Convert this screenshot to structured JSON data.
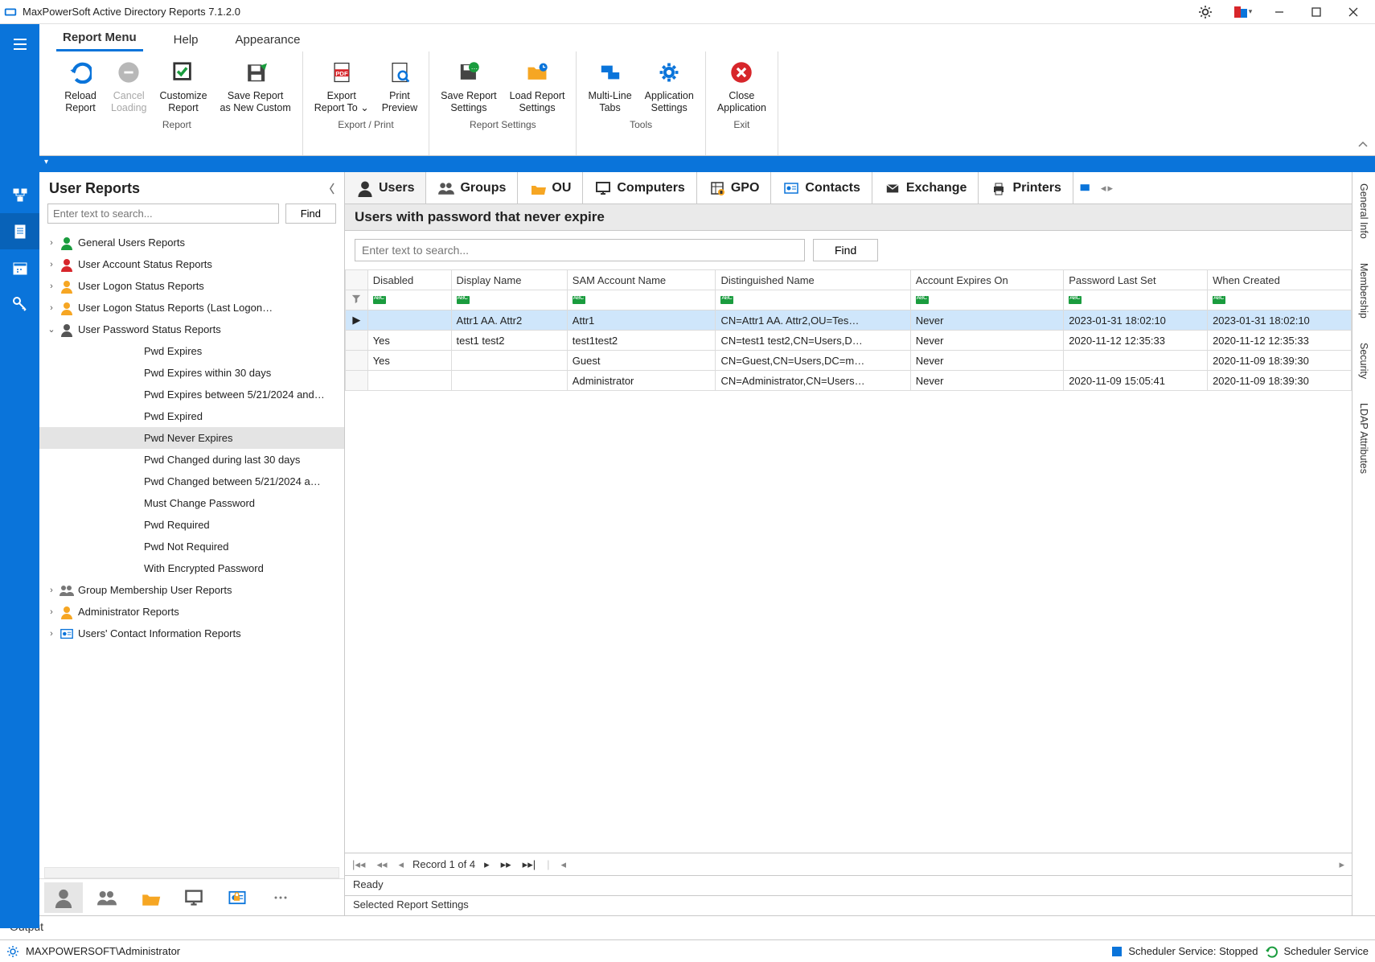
{
  "title": "MaxPowerSoft Active Directory Reports 7.1.2.0",
  "menu_tabs": [
    "Report Menu",
    "Help",
    "Appearance"
  ],
  "ribbon": {
    "groups": [
      {
        "caption": "Report",
        "items": [
          {
            "id": "reload",
            "l1": "Reload",
            "l2": "Report"
          },
          {
            "id": "cancel",
            "l1": "Cancel",
            "l2": "Loading",
            "disabled": true
          },
          {
            "id": "customize",
            "l1": "Customize",
            "l2": "Report"
          },
          {
            "id": "savecustom",
            "l1": "Save Report",
            "l2": "as New Custom"
          }
        ]
      },
      {
        "caption": "Export / Print",
        "items": [
          {
            "id": "export",
            "l1": "Export",
            "l2": "Report To ⌄"
          },
          {
            "id": "preview",
            "l1": "Print",
            "l2": "Preview"
          }
        ]
      },
      {
        "caption": "Report Settings",
        "items": [
          {
            "id": "savesettings",
            "l1": "Save Report",
            "l2": "Settings"
          },
          {
            "id": "loadsettings",
            "l1": "Load Report",
            "l2": "Settings"
          }
        ]
      },
      {
        "caption": "Tools",
        "items": [
          {
            "id": "multiline",
            "l1": "Multi-Line",
            "l2": "Tabs"
          },
          {
            "id": "appsettings",
            "l1": "Application",
            "l2": "Settings"
          }
        ]
      },
      {
        "caption": "Exit",
        "items": [
          {
            "id": "close",
            "l1": "Close",
            "l2": "Application"
          }
        ]
      }
    ]
  },
  "left_panel": {
    "title": "User Reports",
    "placeholder": "Enter text to search...",
    "find": "Find"
  },
  "tree": {
    "nodes": [
      {
        "level": 0,
        "exp": ">",
        "icon": "user-green",
        "label": "General Users Reports"
      },
      {
        "level": 0,
        "exp": ">",
        "icon": "user-red",
        "label": "User Account Status Reports"
      },
      {
        "level": 0,
        "exp": ">",
        "icon": "user-orange",
        "label": "User Logon Status Reports"
      },
      {
        "level": 0,
        "exp": ">",
        "icon": "user-orange",
        "label": "User Logon Status Reports (Last Logon…"
      },
      {
        "level": 0,
        "exp": "v",
        "icon": "user-pwd",
        "label": "User Password Status Reports"
      },
      {
        "level": 2,
        "label": "Pwd Expires"
      },
      {
        "level": 2,
        "label": "Pwd Expires within 30 days"
      },
      {
        "level": 2,
        "label": "Pwd Expires between 5/21/2024 and…"
      },
      {
        "level": 2,
        "label": "Pwd Expired"
      },
      {
        "level": 2,
        "label": "Pwd Never Expires",
        "sel": true
      },
      {
        "level": 2,
        "label": "Pwd Changed during last 30 days"
      },
      {
        "level": 2,
        "label": "Pwd Changed between 5/21/2024 a…"
      },
      {
        "level": 2,
        "label": "Must Change Password"
      },
      {
        "level": 2,
        "label": "Pwd Required"
      },
      {
        "level": 2,
        "label": "Pwd Not Required"
      },
      {
        "level": 2,
        "label": "With Encrypted Password"
      },
      {
        "level": 0,
        "exp": ">",
        "icon": "group",
        "label": "Group Membership User Reports"
      },
      {
        "level": 0,
        "exp": ">",
        "icon": "admin",
        "label": "Administrator Reports"
      },
      {
        "level": 0,
        "exp": ">",
        "icon": "card",
        "label": "Users' Contact Information Reports"
      }
    ]
  },
  "cat_tabs": [
    "Users",
    "Groups",
    "OU",
    "Computers",
    "GPO",
    "Contacts",
    "Exchange",
    "Printers"
  ],
  "grid": {
    "title": "Users with password that never expire",
    "placeholder": "Enter text to search...",
    "find": "Find",
    "cols": [
      "Disabled",
      "Display Name",
      "SAM Account Name",
      "Distinguished Name",
      "Account Expires On",
      "Password Last Set",
      "When Created"
    ],
    "rows": [
      {
        "sel": true,
        "hdr": "▶",
        "c": [
          "",
          "Attr1 AA. Attr2",
          "Attr1",
          "CN=Attr1 AA. Attr2,OU=Tes…",
          "Never",
          "2023-01-31 18:02:10",
          "2023-01-31 18:02:10"
        ]
      },
      {
        "c": [
          "Yes",
          "test1 test2",
          "test1test2",
          "CN=test1 test2,CN=Users,D…",
          "Never",
          "2020-11-12 12:35:33",
          "2020-11-12 12:35:33"
        ]
      },
      {
        "c": [
          "Yes",
          "",
          "Guest",
          "CN=Guest,CN=Users,DC=m…",
          "Never",
          "",
          "2020-11-09 18:39:30"
        ]
      },
      {
        "c": [
          "",
          "",
          "Administrator",
          "CN=Administrator,CN=Users…",
          "Never",
          "2020-11-09 15:05:41",
          "2020-11-09 18:39:30"
        ]
      }
    ],
    "pager": "Record 1 of 4",
    "ready": "Ready",
    "settings": "Selected Report Settings"
  },
  "right_tabs": [
    "General Info",
    "Membership",
    "Security",
    "LDAP Attributes"
  ],
  "output": "Output",
  "status": {
    "user": "MAXPOWERSOFT\\Administrator",
    "svc_stopped": "Scheduler Service: Stopped",
    "svc": "Scheduler Service"
  }
}
